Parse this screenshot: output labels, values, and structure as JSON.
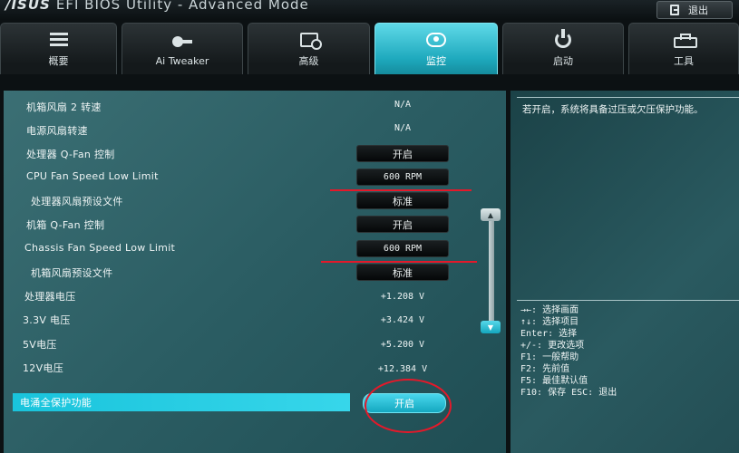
{
  "header": {
    "brand": "/ISUS",
    "title": "EFI BIOS Utility - Advanced Mode",
    "exit_label": "退出"
  },
  "tabs": [
    {
      "label": "概要",
      "icon": "list-icon"
    },
    {
      "label": "Ai Tweaker",
      "icon": "tweaker-icon"
    },
    {
      "label": "高级",
      "icon": "advanced-icon"
    },
    {
      "label": "监控",
      "icon": "monitor-icon",
      "active": true
    },
    {
      "label": "启动",
      "icon": "power-icon"
    },
    {
      "label": "工具",
      "icon": "tool-icon"
    }
  ],
  "rows": [
    {
      "label": "机箱风扇 2 转速",
      "value": "N/A"
    },
    {
      "label": "电源风扇转速",
      "value": "N/A"
    },
    {
      "label": "处理器 Q-Fan 控制",
      "button": "开启"
    },
    {
      "label": "CPU Fan Speed Low Limit",
      "button": "600 RPM"
    },
    {
      "label": "处理器风扇预设文件",
      "button": "标准"
    },
    {
      "label": "机箱 Q-Fan 控制",
      "button": "开启"
    },
    {
      "label": "Chassis Fan Speed Low Limit",
      "button": "600 RPM"
    },
    {
      "label": "机箱风扇预设文件",
      "button": "标准"
    },
    {
      "label": "处理器电压",
      "value": "+1.208 V"
    },
    {
      "label": "3.3V 电压",
      "value": "+3.424 V"
    },
    {
      "label": "5V电压",
      "value": "+5.200 V"
    },
    {
      "label": "12V电压",
      "value": "+12.384 V"
    },
    {
      "label": "电涌全保护功能",
      "button": "开启",
      "selected": true
    }
  ],
  "help": {
    "description": "若开启，系统将具备过压或欠压保护功能。",
    "keys": [
      "→←: 选择画面",
      "↑↓: 选择项目",
      "Enter: 选择",
      "+/-: 更改选项",
      "F1: 一般帮助",
      "F2: 先前值",
      "F5: 最佳默认值",
      "F10: 保存  ESC: 退出"
    ]
  },
  "colors": {
    "accent": "#1ec0d8",
    "annotation": "#e3192a",
    "panel": "#2f6268"
  }
}
